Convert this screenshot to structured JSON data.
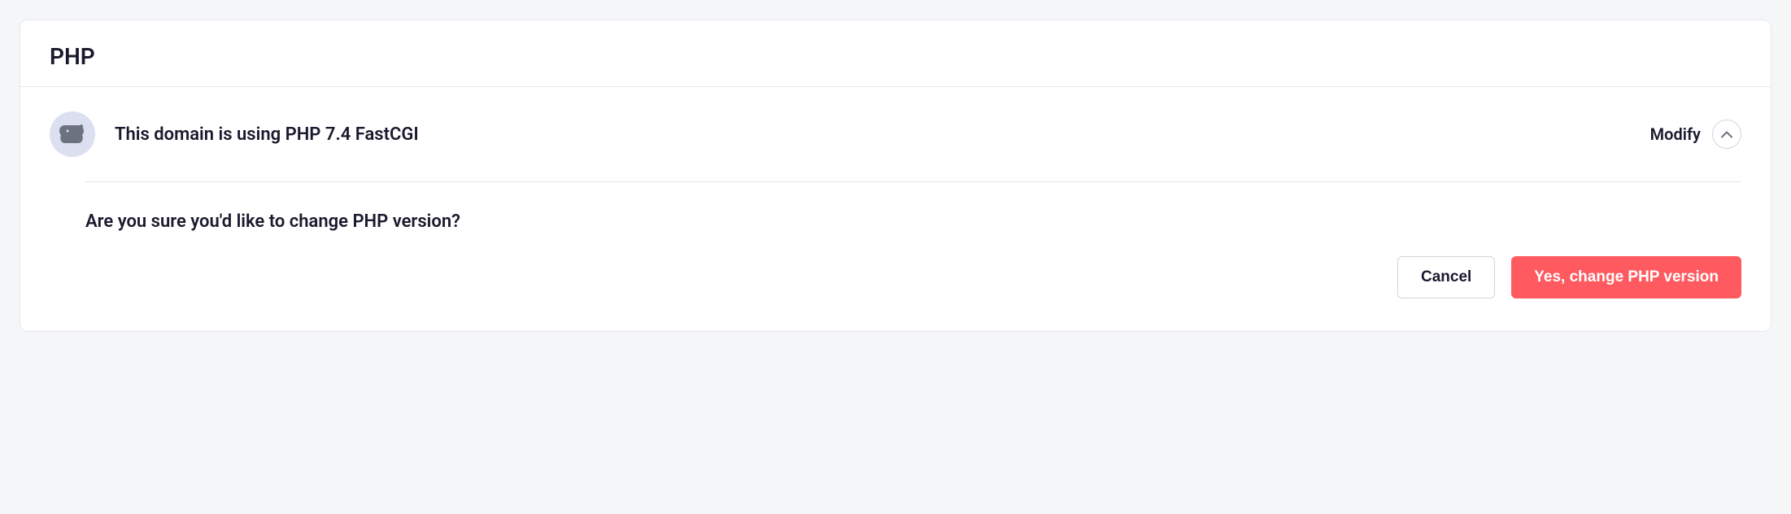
{
  "header": {
    "title": "PHP"
  },
  "status": {
    "text": "This domain is using PHP 7.4 FastCGI",
    "modify_label": "Modify"
  },
  "confirm": {
    "question": "Are you sure you'd like to change PHP version?",
    "cancel_label": "Cancel",
    "confirm_label": "Yes, change PHP version"
  }
}
